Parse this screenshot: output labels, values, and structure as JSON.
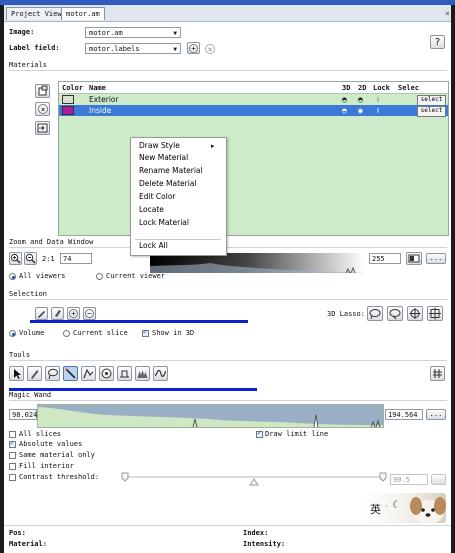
{
  "tabs": [
    {
      "label": "Project View",
      "active": false
    },
    {
      "label": "motor.am",
      "active": true
    }
  ],
  "tab_close": "×",
  "image": {
    "label": "Image:",
    "value": "motor.am"
  },
  "label_field": {
    "label": "Label field:",
    "value": "motor.labels"
  },
  "help_button": "?",
  "materials": {
    "section_label": "Materials",
    "columns": [
      "Color",
      "Name",
      "3D",
      "2D",
      "Lock",
      "Selec"
    ],
    "rows": [
      {
        "name": "Exterior",
        "color": "#d8e2c8",
        "selected": false,
        "select_label": "select"
      },
      {
        "name": "Inside",
        "color": "#b0189e",
        "selected": true,
        "select_label": "select"
      }
    ]
  },
  "context_menu": {
    "items": [
      "Draw Style",
      "New Material",
      "Rename Material",
      "Delete Material",
      "Edit Color",
      "Locate",
      "Lock Material",
      "Lock All"
    ],
    "submenu_arrow": "▸"
  },
  "zoom": {
    "section_label": "Zoom and Data Window",
    "ratio": "2:1",
    "min_value": "74",
    "max_value": "255",
    "dots_button": "...",
    "radio_all": "All viewers",
    "radio_current": "Current viewer",
    "selected_radio": "All viewers"
  },
  "selection": {
    "section_label": "Selection",
    "lasso_label": "3D Lasso:",
    "radio_volume": "Volume",
    "radio_current_slice": "Current slice",
    "show_in_3d": "Show in 3D",
    "show_in_3d_checked": true
  },
  "tools": {
    "section_label": "Tools",
    "icons": [
      "pointer-tool-icon",
      "brush-tool-icon",
      "lasso-tool-icon",
      "magic-wand-tool-icon",
      "propagating-contour-tool-icon",
      "blow-tool-icon",
      "top-hat-tool-icon",
      "threshold-tool-icon",
      "smooth-tool-icon"
    ]
  },
  "magic_wand": {
    "section_label": "Magic Wand",
    "min_value": "98.0242",
    "max_value": "194.564",
    "dots_button": "...",
    "draw_limit_line": "Draw limit line",
    "draw_limit_line_checked": true,
    "options": [
      {
        "label": "All slices",
        "checked": false
      },
      {
        "label": "Absolute values",
        "checked": true
      },
      {
        "label": "Same material only",
        "checked": false
      },
      {
        "label": "Fill interior",
        "checked": false
      },
      {
        "label": "Contrast threshold:",
        "checked": false
      }
    ],
    "contrast_value": "90.5"
  },
  "ime": {
    "char": "英",
    "sep": "·",
    "moon": "☾"
  },
  "status": {
    "pos_label": "Pos:",
    "material_label": "Material:",
    "index_label": "Index:",
    "intensity_label": "Intensity:"
  },
  "colors": {
    "accent_bar": "#0c1fd0",
    "list_bg": "#cdebc8",
    "selected_row": "#3a7ad6",
    "title_bar": "#2f5bbf"
  }
}
